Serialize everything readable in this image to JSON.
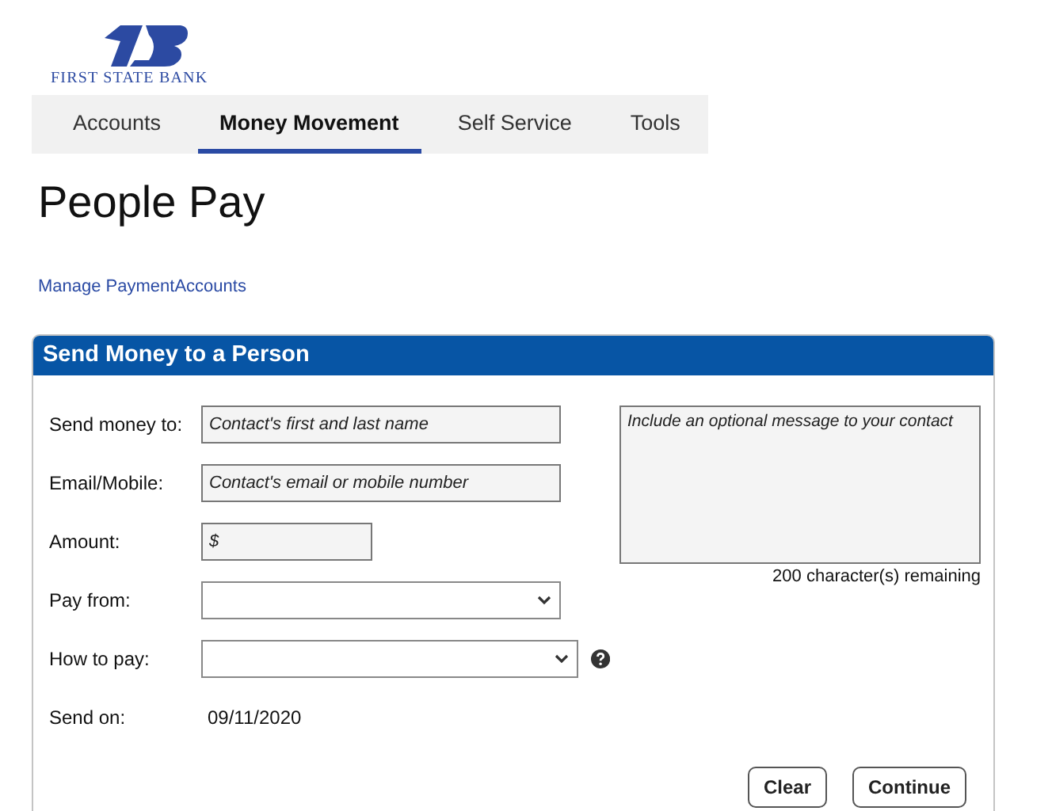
{
  "bank": {
    "name": "FIRST STATE BANK"
  },
  "tabs": [
    {
      "label": "Accounts",
      "selected": false
    },
    {
      "label": "Money Movement",
      "selected": true
    },
    {
      "label": "Self Service",
      "selected": false
    },
    {
      "label": "Tools",
      "selected": false
    }
  ],
  "page": {
    "title": "People Pay",
    "link": "Manage PaymentAccounts"
  },
  "panel": {
    "title": "Send Money to a Person",
    "fields": [
      {
        "kind": "text",
        "label": "Send money to:",
        "placeholder": "Contact's first and last name"
      },
      {
        "kind": "text",
        "label": "Email/Mobile:",
        "placeholder": "Contact's email or mobile number"
      },
      {
        "kind": "amount",
        "label": "Amount:",
        "placeholder": "$"
      },
      {
        "kind": "select",
        "label": "Pay from:",
        "help": false
      },
      {
        "kind": "select",
        "label": "How to pay:",
        "help": true
      },
      {
        "kind": "static",
        "label": "Send on:",
        "value": "09/11/2020"
      }
    ],
    "message": {
      "placeholder": "Include an optional message to your contact",
      "counter": "200 character(s) remaining"
    },
    "buttons": [
      "Clear",
      "Continue"
    ]
  }
}
